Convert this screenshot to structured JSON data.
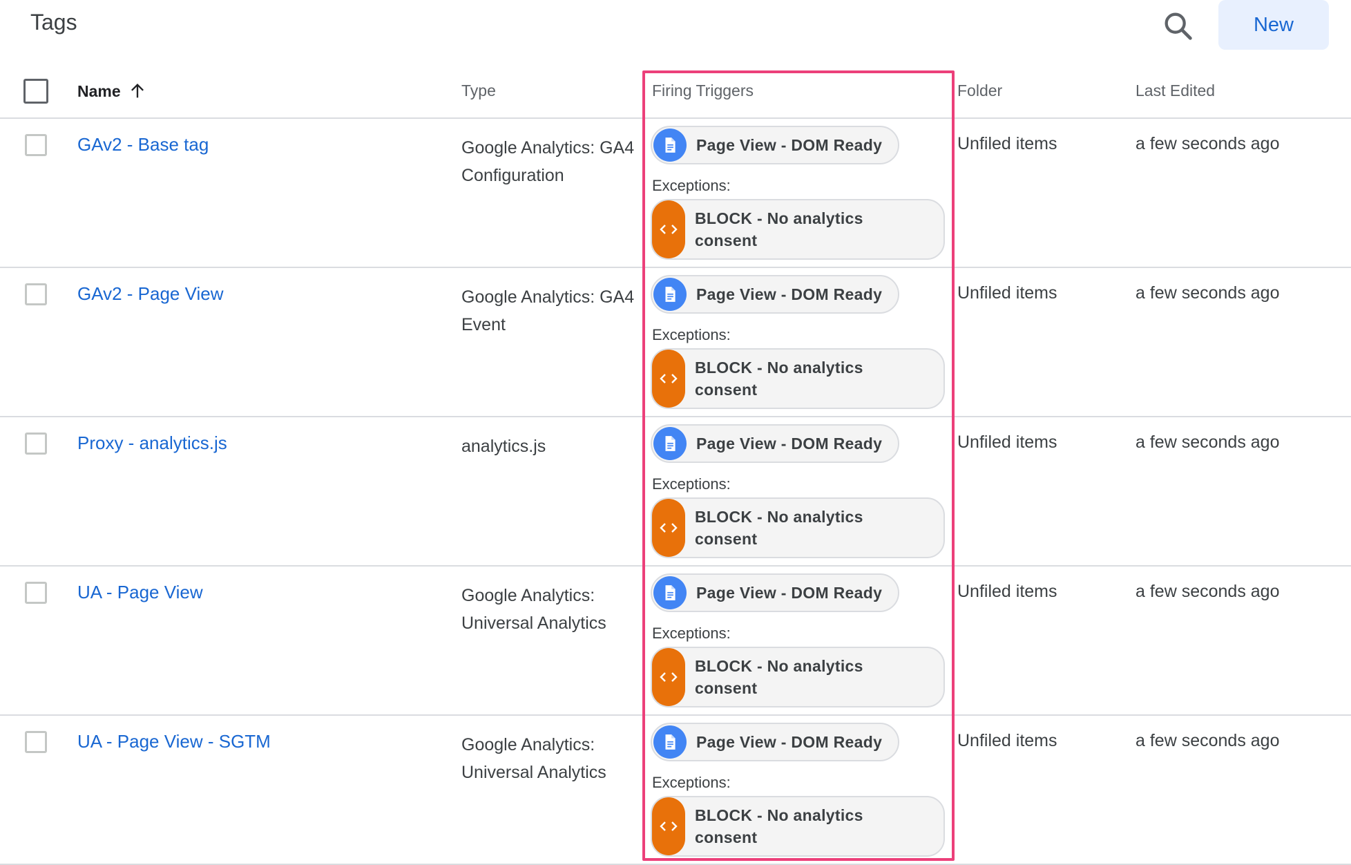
{
  "header": {
    "title": "Tags",
    "new_button": "New",
    "search_icon": "search-icon"
  },
  "columns": {
    "name": "Name",
    "type": "Type",
    "firing_triggers": "Firing Triggers",
    "folder": "Folder",
    "last_edited": "Last Edited"
  },
  "sort_icon": "arrow-up-icon",
  "colors": {
    "link": "#1967d2",
    "highlight": "#ec407a",
    "trigger_icon": "#4285f4",
    "exception_icon": "#e8710a",
    "new_button_bg": "#e8f0fe"
  },
  "rows": [
    {
      "name": "GAv2 - Base tag",
      "type": "Google Analytics: GA4 Configuration",
      "trigger": "Page View - DOM Ready",
      "exceptions_label": "Exceptions:",
      "exception_line1": "BLOCK - No analytics",
      "exception_line2": "consent",
      "folder": "Unfiled items",
      "last_edited": "a few seconds ago"
    },
    {
      "name": "GAv2 - Page View",
      "type": "Google Analytics: GA4 Event",
      "trigger": "Page View - DOM Ready",
      "exceptions_label": "Exceptions:",
      "exception_line1": "BLOCK - No analytics",
      "exception_line2": "consent",
      "folder": "Unfiled items",
      "last_edited": "a few seconds ago"
    },
    {
      "name": "Proxy - analytics.js",
      "type": "analytics.js",
      "trigger": "Page View - DOM Ready",
      "exceptions_label": "Exceptions:",
      "exception_line1": "BLOCK - No analytics",
      "exception_line2": "consent",
      "folder": "Unfiled items",
      "last_edited": "a few seconds ago"
    },
    {
      "name": "UA - Page View",
      "type": "Google Analytics: Universal Analytics",
      "trigger": "Page View - DOM Ready",
      "exceptions_label": "Exceptions:",
      "exception_line1": "BLOCK - No analytics",
      "exception_line2": "consent",
      "folder": "Unfiled items",
      "last_edited": "a few seconds ago"
    },
    {
      "name": "UA - Page View - SGTM",
      "type": "Google Analytics: Universal Analytics",
      "trigger": "Page View - DOM Ready",
      "exceptions_label": "Exceptions:",
      "exception_line1": "BLOCK - No analytics",
      "exception_line2": "consent",
      "folder": "Unfiled items",
      "last_edited": "a few seconds ago"
    }
  ]
}
